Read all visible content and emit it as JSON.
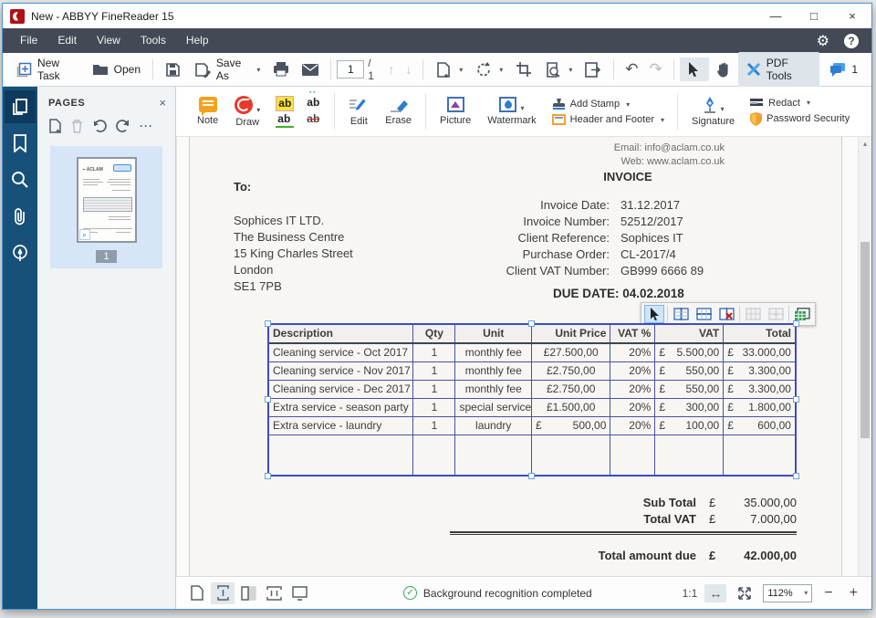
{
  "window": {
    "title": "New - ABBYY FineReader 15"
  },
  "menu": {
    "items": [
      "File",
      "Edit",
      "View",
      "Tools",
      "Help"
    ]
  },
  "glyphs": {
    "minimize": "—",
    "maximize": "□",
    "close": "×",
    "gear": "⚙",
    "help": "?",
    "page_up": "↑",
    "page_down": "↓",
    "undo": "↶",
    "redo": "↷",
    "caret": "▾",
    "panel_close": "×",
    "more": "···",
    "scroll_up": "▴",
    "check": "✓",
    "fit_width": "↔",
    "minus": "−",
    "plus": "+",
    "highlight_label": "ab"
  },
  "toolbar": {
    "new_task": "New Task",
    "open": "Open",
    "save_as": "Save As",
    "page_current": "1",
    "page_total": "/ 1",
    "pdf_tools": "PDF Tools",
    "comments_count": "1"
  },
  "edit_toolbar": {
    "note": "Note",
    "draw": "Draw",
    "edit": "Edit",
    "erase": "Erase",
    "picture": "Picture",
    "watermark": "Watermark",
    "add_stamp": "Add Stamp",
    "header_footer": "Header and Footer",
    "signature": "Signature",
    "redact": "Redact",
    "password": "Password Security"
  },
  "pages_panel": {
    "title": "PAGES",
    "page_number": "1"
  },
  "document": {
    "contact_lines": [
      "Email: info@aclam.co.uk",
      "Web: www.aclam.co.uk"
    ],
    "title": "INVOICE",
    "to_label": "To:",
    "address_lines": [
      "Sophices IT LTD.",
      "The Business Centre",
      "15 King Charles Street",
      "London",
      "SE1 7PB"
    ],
    "meta": [
      {
        "label": "Invoice Date:",
        "value": "31.12.2017"
      },
      {
        "label": "Invoice Number:",
        "value": "52512/2017"
      },
      {
        "label": "Client Reference:",
        "value": "Sophices IT"
      },
      {
        "label": "Purchase Order:",
        "value": "CL-2017/4"
      },
      {
        "label": "Client VAT Number:",
        "value": "GB999 6666 89"
      }
    ],
    "due_date": "DUE DATE: 04.02.2018",
    "table": {
      "columns": [
        {
          "label": "Description",
          "align": "left",
          "width": "27.5%",
          "header_align": "left"
        },
        {
          "label": "Qty",
          "align": "center",
          "width": "8%",
          "header_align": "center"
        },
        {
          "label": "Unit",
          "align": "center",
          "width": "14.5%",
          "header_align": "center"
        },
        {
          "label": "Unit Price",
          "align": "center",
          "width": "15%",
          "header_align": "right"
        },
        {
          "label": "VAT %",
          "align": "right",
          "width": "8.5%",
          "header_align": "right"
        },
        {
          "label": "VAT",
          "align": "split",
          "width": "13%",
          "header_align": "right"
        },
        {
          "label": "Total",
          "align": "split",
          "width": "13.5%",
          "header_align": "right"
        }
      ],
      "rows": [
        [
          "Cleaning service - Oct 2017",
          "1",
          "monthly fee",
          "£27.500,00",
          "20%",
          {
            "c": "£",
            "v": "5.500,00"
          },
          {
            "c": "£",
            "v": "33.000,00"
          }
        ],
        [
          "Cleaning service - Nov 2017",
          "1",
          "monthly fee",
          "£2.750,00",
          "20%",
          {
            "c": "£",
            "v": "550,00"
          },
          {
            "c": "£",
            "v": "3.300,00"
          }
        ],
        [
          "Cleaning service - Dec 2017",
          "1",
          "monthly fee",
          "£2.750,00",
          "20%",
          {
            "c": "£",
            "v": "550,00"
          },
          {
            "c": "£",
            "v": "3.300,00"
          }
        ],
        [
          "Extra service - season party",
          "1",
          "special service",
          "£1.500,00",
          "20%",
          {
            "c": "£",
            "v": "300,00"
          },
          {
            "c": "£",
            "v": "1.800,00"
          }
        ],
        [
          "Extra service - laundry",
          "1",
          "laundry",
          {
            "c": "£",
            "v": "500,00"
          },
          "20%",
          {
            "c": "£",
            "v": "100,00"
          },
          {
            "c": "£",
            "v": "600,00"
          }
        ]
      ]
    },
    "totals": {
      "sub_total": {
        "label": "Sub Total",
        "currency": "£",
        "amount": "35.000,00"
      },
      "total_vat": {
        "label": "Total VAT",
        "currency": "£",
        "amount": "7.000,00"
      },
      "total_due": {
        "label": "Total amount due",
        "currency": "£",
        "amount": "42.000,00"
      }
    }
  },
  "statusbar": {
    "status_text": "Background recognition completed",
    "ratio": "1:1",
    "zoom": "112%"
  }
}
